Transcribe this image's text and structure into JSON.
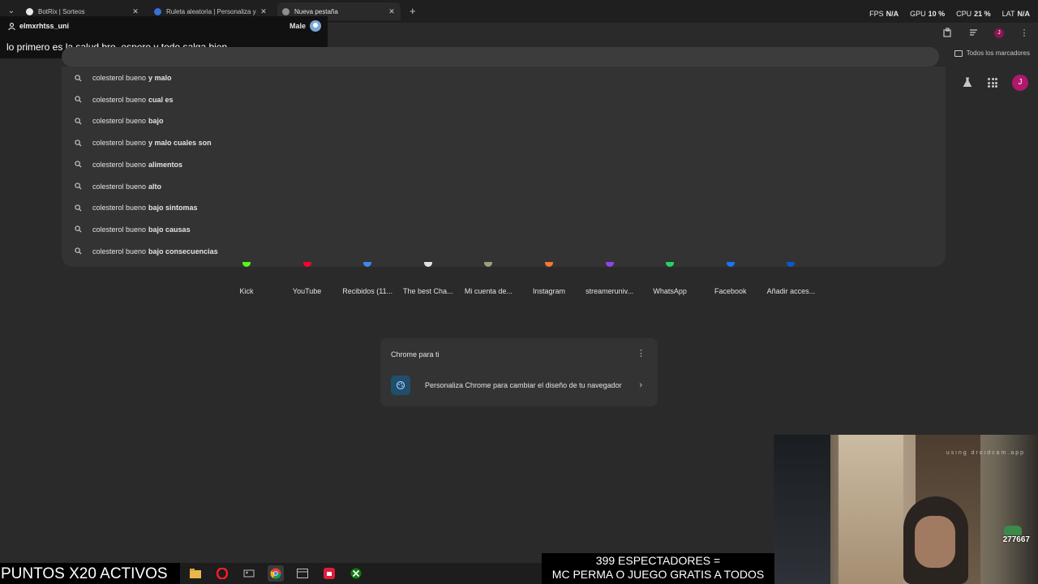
{
  "tabs": [
    {
      "title": "BotRix | Sorteos",
      "favicon": "botrix-icon",
      "active": false
    },
    {
      "title": "Ruleta aleatoria | Personaliza y",
      "favicon": "wheel-icon",
      "active": false
    },
    {
      "title": "Nueva pestaña",
      "favicon": "chrome-icon",
      "active": true
    }
  ],
  "perf": {
    "fps_label": "FPS",
    "fps_value": "N/A",
    "gpu_label": "GPU",
    "gpu_value": "10 %",
    "cpu_label": "CPU",
    "cpu_value": "21 %",
    "lat_label": "LAT",
    "lat_value": "N/A"
  },
  "chat": {
    "username": "elmxrhtss_uni",
    "gender": "Male",
    "message": "lo primero es la salud bro, espero y todo salga bien"
  },
  "bookmarks": {
    "label": "Todos los marcadores"
  },
  "profile": {
    "initial": "J"
  },
  "suggestions": [
    {
      "prefix": "colesterol bueno",
      "suffix": "y malo"
    },
    {
      "prefix": "colesterol bueno",
      "suffix": "cual es"
    },
    {
      "prefix": "colesterol bueno",
      "suffix": "bajo"
    },
    {
      "prefix": "colesterol bueno",
      "suffix": "y malo cuales son"
    },
    {
      "prefix": "colesterol bueno",
      "suffix": "alimentos"
    },
    {
      "prefix": "colesterol bueno",
      "suffix": "alto"
    },
    {
      "prefix": "colesterol bueno",
      "suffix": "bajo sintomas"
    },
    {
      "prefix": "colesterol bueno",
      "suffix": "bajo causas"
    },
    {
      "prefix": "colesterol bueno",
      "suffix": "bajo consecuencias"
    }
  ],
  "shortcuts": [
    {
      "label": "Kick",
      "color": "#53fc18"
    },
    {
      "label": "YouTube",
      "color": "#ff0033"
    },
    {
      "label": "Recibidos (11...",
      "color": "#4285f4"
    },
    {
      "label": "The best Cha...",
      "color": "#e3e3e3"
    },
    {
      "label": "Mi cuenta de...",
      "color": "#9e9e7a"
    },
    {
      "label": "Instagram",
      "color": "#f77737"
    },
    {
      "label": "streameruniv...",
      "color": "#8e44ec"
    },
    {
      "label": "WhatsApp",
      "color": "#25d366"
    },
    {
      "label": "Facebook",
      "color": "#1877f2"
    },
    {
      "label": "Añadir acces...",
      "color": "#0b57d0"
    }
  ],
  "card": {
    "title": "Chrome para ti",
    "row_text": "Personaliza Chrome para cambiar el diseño de tu navegador"
  },
  "webcam": {
    "overlay_text": "using droidcam.app",
    "badge": "277667"
  },
  "stream": {
    "puntos": "PUNTOS X20 ACTIVOS",
    "spectators_line1": "399 ESPECTADORES =",
    "spectators_line2": "MC PERMA O JUEGO GRATIS A TODOS"
  },
  "taskbar_apps": [
    "file-explorer-icon",
    "opera-icon",
    "game-launcher-icon",
    "chrome-icon",
    "media-app-icon",
    "red-app-icon",
    "xbox-icon"
  ]
}
